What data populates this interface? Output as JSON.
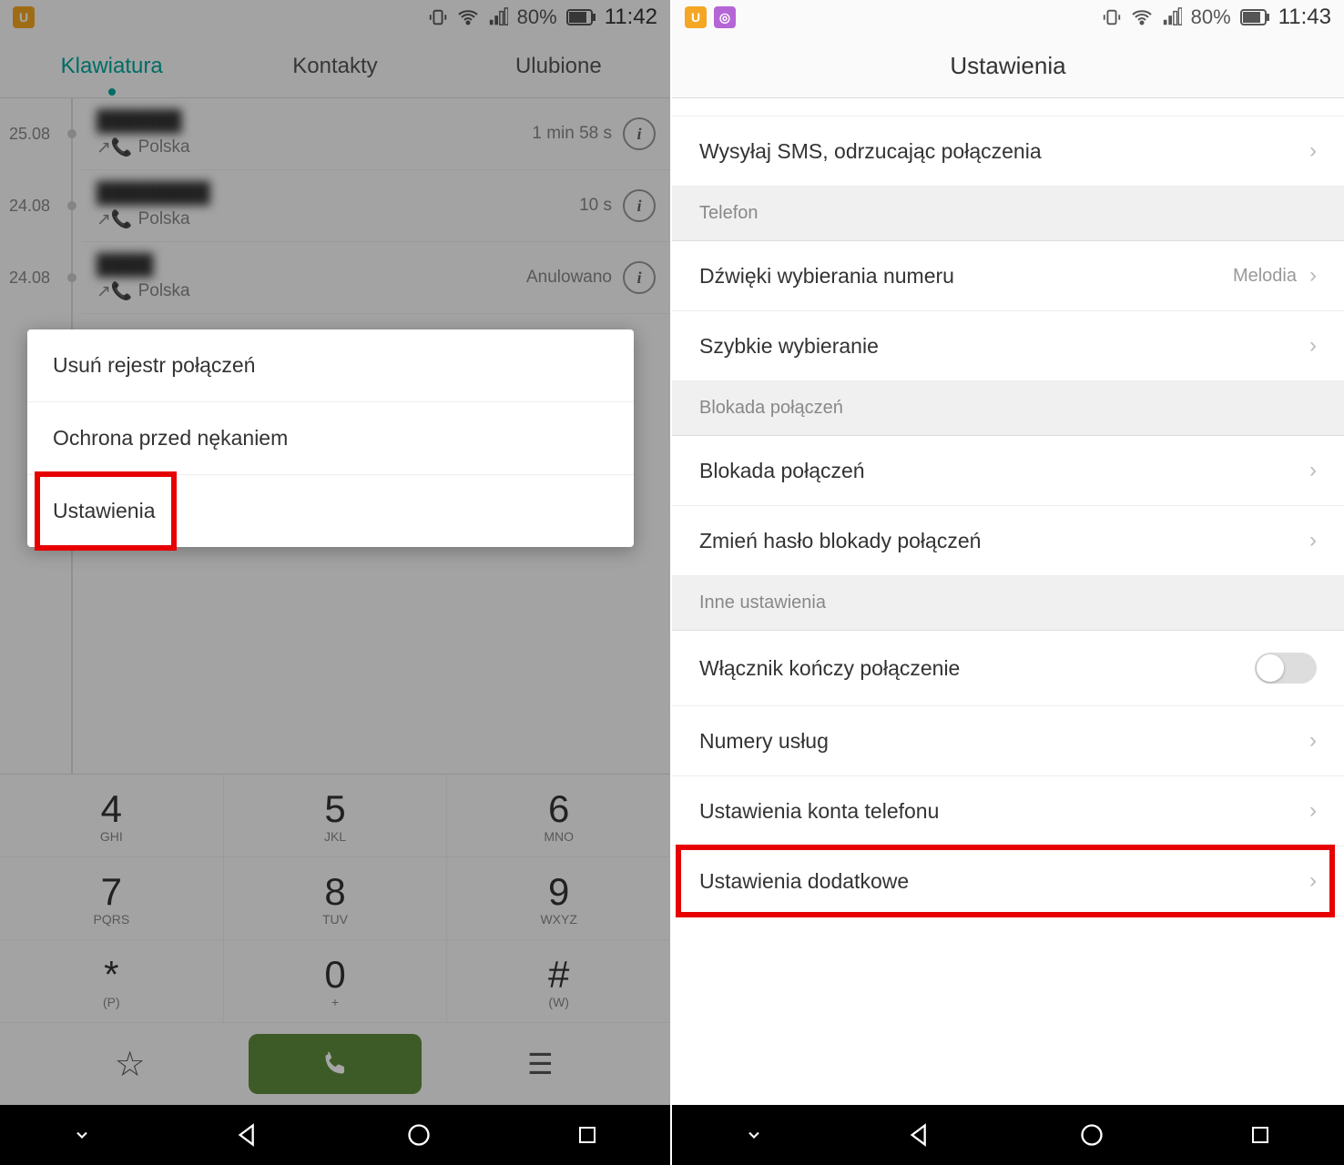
{
  "left": {
    "status": {
      "battery": "80%",
      "time": "11:42"
    },
    "tabs": [
      "Klawiatura",
      "Kontakty",
      "Ulubione"
    ],
    "calls": [
      {
        "date": "25.08",
        "name": "██████",
        "country": "Polska",
        "duration": "1 min  58 s"
      },
      {
        "date": "24.08",
        "name": "████████",
        "country": "Polska",
        "duration": "10 s"
      },
      {
        "date": "24.08",
        "name": "████",
        "country": "Polska",
        "duration": "Anulowano"
      }
    ],
    "popup": [
      "Usuń rejestr połączeń",
      "Ochrona przed nękaniem",
      "Ustawienia"
    ],
    "dialpad": [
      [
        {
          "n": "4",
          "l": "GHI"
        },
        {
          "n": "5",
          "l": "JKL"
        },
        {
          "n": "6",
          "l": "MNO"
        }
      ],
      [
        {
          "n": "7",
          "l": "PQRS"
        },
        {
          "n": "8",
          "l": "TUV"
        },
        {
          "n": "9",
          "l": "WXYZ"
        }
      ],
      [
        {
          "n": "*",
          "l": "(P)"
        },
        {
          "n": "0",
          "l": "+"
        },
        {
          "n": "#",
          "l": "(W)"
        }
      ]
    ]
  },
  "right": {
    "status": {
      "battery": "80%",
      "time": "11:43"
    },
    "title": "Ustawienia",
    "items": {
      "sms": "Wysyłaj SMS, odrzucając połączenia",
      "phone_header": "Telefon",
      "dial_sounds": "Dźwięki wybierania numeru",
      "melody": "Melodia",
      "speed_dial": "Szybkie wybieranie",
      "block_header": "Blokada połączeń",
      "block": "Blokada połączeń",
      "change_pw": "Zmień hasło blokady połączeń",
      "other_header": "Inne ustawienia",
      "power_ends": "Włącznik kończy połączenie",
      "service_nums": "Numery usług",
      "phone_account": "Ustawienia konta telefonu",
      "additional": "Ustawienia dodatkowe"
    }
  }
}
